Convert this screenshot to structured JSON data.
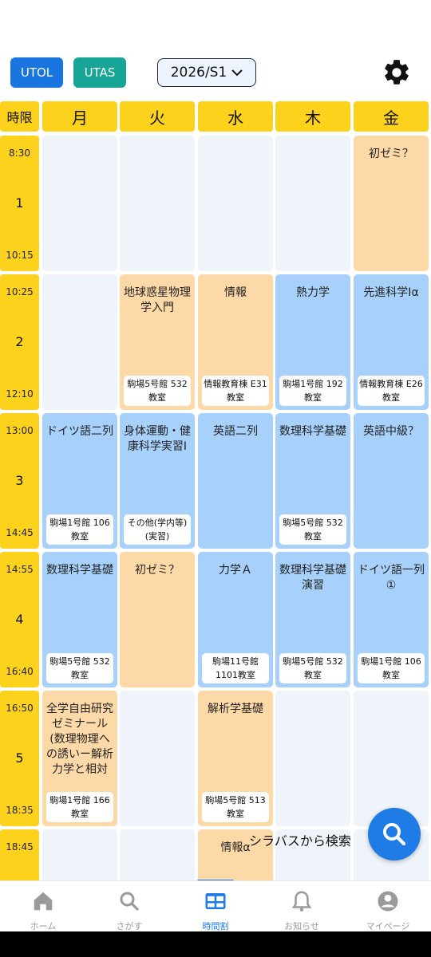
{
  "header": {
    "utol_label": "UTOL",
    "utas_label": "UTAS",
    "semester": "2026/S1"
  },
  "days": [
    "時限",
    "月",
    "火",
    "水",
    "木",
    "金"
  ],
  "periods": [
    {
      "start": "8:30",
      "num": "1",
      "end": "10:15"
    },
    {
      "start": "10:25",
      "num": "2",
      "end": "12:10"
    },
    {
      "start": "13:00",
      "num": "3",
      "end": "14:45"
    },
    {
      "start": "14:55",
      "num": "4",
      "end": "16:40"
    },
    {
      "start": "16:50",
      "num": "5",
      "end": "18:35"
    },
    {
      "start": "18:45",
      "num": "",
      "end": ""
    }
  ],
  "timetable": [
    [
      {
        "type": "empty"
      },
      {
        "type": "empty"
      },
      {
        "type": "empty"
      },
      {
        "type": "empty"
      },
      {
        "type": "orange",
        "name": "初ゼミ？",
        "room": ""
      }
    ],
    [
      {
        "type": "empty"
      },
      {
        "type": "orange",
        "name": "地球惑星物理学入門",
        "room": "駒場5号館 532 教室"
      },
      {
        "type": "orange",
        "name": "情報",
        "room": "情報教育棟 E31 教室"
      },
      {
        "type": "blue",
        "name": "熱力学",
        "room": "駒場1号館 192 教室"
      },
      {
        "type": "blue",
        "name": "先進科学Iα",
        "room": "情報教育棟 E26 教室"
      }
    ],
    [
      {
        "type": "blue",
        "name": "ドイツ語二列",
        "room": "駒場1号館 106 教室"
      },
      {
        "type": "blue",
        "name": "身体運動・健康科学実習I",
        "room": "その他(学内等) (実習)"
      },
      {
        "type": "blue",
        "name": "英語二列",
        "room": ""
      },
      {
        "type": "blue",
        "name": "数理科学基礎",
        "room": "駒場5号館 532 教室"
      },
      {
        "type": "blue",
        "name": "英語中級？",
        "room": ""
      }
    ],
    [
      {
        "type": "blue",
        "name": "数理科学基礎",
        "room": "駒場5号館 532 教室"
      },
      {
        "type": "orange",
        "name": "初ゼミ？",
        "room": ""
      },
      {
        "type": "blue",
        "name": "力学Ａ",
        "room": "駒場11号館 1101教室"
      },
      {
        "type": "blue",
        "name": "数理科学基礎演習",
        "room": "駒場5号館 532 教室"
      },
      {
        "type": "blue",
        "name": "ドイツ語一列①",
        "room": "駒場1号館 106 教室"
      }
    ],
    [
      {
        "type": "orange",
        "name": "全学自由研究ゼミナール(数理物理への誘いー解析力学と相対性…",
        "room": "駒場1号館 166 教室"
      },
      {
        "type": "empty"
      },
      {
        "type": "orange",
        "name": "解析学基礎",
        "room": "駒場5号館 513 教室"
      },
      {
        "type": "empty"
      },
      {
        "type": "empty"
      }
    ],
    [
      {
        "type": "empty"
      },
      {
        "type": "empty"
      },
      {
        "type": "orange",
        "name": "情報α",
        "room": ""
      },
      {
        "type": "empty"
      },
      {
        "type": "empty"
      }
    ]
  ],
  "search_fab_label": "シラバスから検索",
  "nav": [
    {
      "label": "ホーム",
      "icon": "home-icon",
      "active": false
    },
    {
      "label": "さがす",
      "icon": "search-icon",
      "active": false
    },
    {
      "label": "時間割",
      "icon": "timetable-icon",
      "active": true
    },
    {
      "label": "お知らせ",
      "icon": "bell-icon",
      "active": false
    },
    {
      "label": "マイページ",
      "icon": "account-icon",
      "active": false
    }
  ],
  "colors": {
    "yellow": "#fdd21c",
    "blue_cell": "#a7d1fb",
    "orange_cell": "#fed9a8",
    "empty_cell": "#eff4fa",
    "accent": "#1f7ce6",
    "utol": "#1976e0",
    "utas": "#16a597"
  }
}
